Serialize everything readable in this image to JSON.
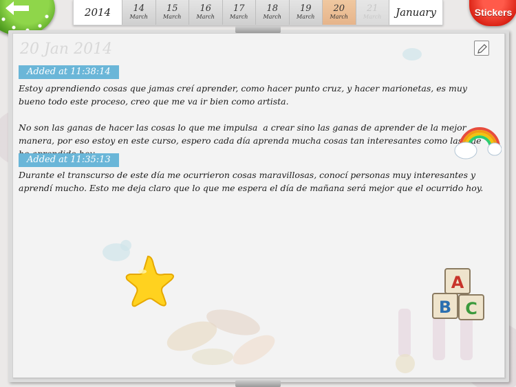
{
  "header": {
    "year": "2014",
    "days": [
      {
        "num": "14",
        "month": "March",
        "state": "normal"
      },
      {
        "num": "15",
        "month": "March",
        "state": "normal"
      },
      {
        "num": "16",
        "month": "March",
        "state": "normal"
      },
      {
        "num": "17",
        "month": "March",
        "state": "normal"
      },
      {
        "num": "18",
        "month": "March",
        "state": "normal"
      },
      {
        "num": "19",
        "month": "March",
        "state": "normal"
      },
      {
        "num": "20",
        "month": "March",
        "state": "selected"
      },
      {
        "num": "21",
        "month": "March",
        "state": "disabled"
      }
    ],
    "month": "January",
    "stickers_label": "Stickers"
  },
  "entry": {
    "date": "20 Jan 2014",
    "notes": [
      {
        "time_label": "Added at 11:38:14",
        "text": "Estoy aprendiendo cosas que jamas creí aprender, como hacer punto cruz, y hacer marionetas, es muy bueno todo este proceso, creo que me va ir bien como artista.\n\nNo son las ganas de hacer las cosas lo que me impulsa  a crear sino las ganas de aprender de la mejor manera, por eso estoy en este curso, espero cada día aprenda mucha cosas tan interesantes como las que he aprendido hoy."
      },
      {
        "time_label": "Added at 11:35:13",
        "text": "Durante el transcurso de este día me ocurrieron cosas maravillosas, conocí personas muy interesantes y aprendí mucho. Esto me deja claro que lo que me espera el día de mañana será mejor que el ocurrido hoy."
      }
    ]
  },
  "stickers": {
    "blocks": [
      "A",
      "B",
      "C"
    ]
  },
  "colors": {
    "time_tag": "#6ab6d8",
    "selected_day": "#e6b48a",
    "back_button": "#4d9a1e",
    "stickers_button": "#d81f12"
  }
}
